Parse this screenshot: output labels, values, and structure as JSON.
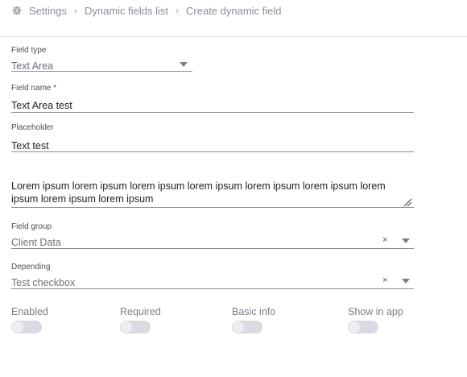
{
  "breadcrumb": {
    "items": [
      "Settings",
      "Dynamic fields list",
      "Create dynamic field"
    ],
    "separator": "›"
  },
  "form": {
    "field_type": {
      "label": "Field type",
      "value": "Text Area"
    },
    "field_name": {
      "label": "Field name *",
      "value": "Text Area test"
    },
    "placeholder": {
      "label": "Placeholder",
      "value": "Text test"
    },
    "textarea": {
      "value": "Lorem ipsum lorem ipsum lorem ipsum lorem ipsum lorem ipsum lorem ipsum lorem ipsum lorem ipsum lorem ipsum"
    },
    "field_group": {
      "label": "Field group",
      "value": "Client Data",
      "clear": "×"
    },
    "depending": {
      "label": "Depending",
      "value": "Test checkbox",
      "clear": "×"
    }
  },
  "toggles": [
    {
      "label": "Enabled",
      "on": false
    },
    {
      "label": "Required",
      "on": false
    },
    {
      "label": "Basic info",
      "on": false
    },
    {
      "label": "Show in app",
      "on": false
    }
  ],
  "icons": {
    "breadcrumb_root": "gear-icon"
  },
  "colors": {
    "divider": "#dcdde0",
    "toggle_track": "#d9dbe2",
    "muted_text": "#8a8f98"
  }
}
